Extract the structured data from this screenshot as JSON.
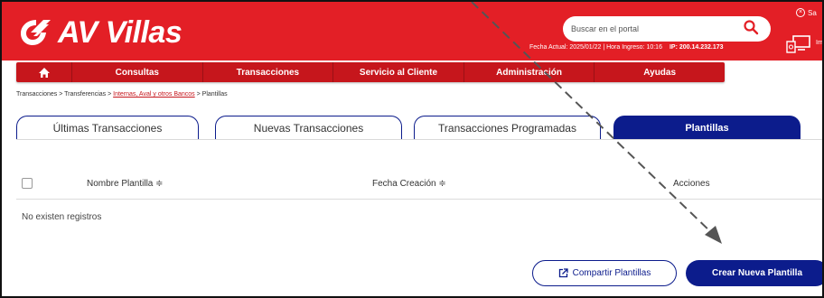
{
  "header": {
    "logo_text": "AV Villas",
    "search_placeholder": "Buscar en el portal",
    "info_date": "Fecha Actual: 2025/01/22 | Hora Ingreso: 10:16",
    "info_ip": "IP: 200.14.232.173",
    "corner_link": "Sa",
    "corner_label": "Im"
  },
  "navbar": {
    "items": [
      "Consultas",
      "Transacciones",
      "Servicio al Cliente",
      "Administración",
      "Ayudas"
    ]
  },
  "breadcrumb": {
    "part1": "Transacciones > Transferencias > ",
    "link": "Internas, Aval y otros Bancos",
    "part2": " > Plantillas"
  },
  "tabs": [
    {
      "label": "Últimas Transacciones",
      "active": false
    },
    {
      "label": "Nuevas Transacciones",
      "active": false
    },
    {
      "label": "Transacciones Programadas",
      "active": false
    },
    {
      "label": "Plantillas",
      "active": true
    }
  ],
  "table": {
    "columns": [
      "Nombre Plantilla ≑",
      "Fecha Creación ≑",
      "Acciones"
    ],
    "empty_text": "No existen registros"
  },
  "buttons": {
    "share": "Compartir Plantillas",
    "create": "Crear Nueva Plantilla"
  },
  "colors": {
    "brand_red": "#e31f26",
    "nav_red": "#c6161c",
    "primary_blue": "#0c1c8c"
  }
}
